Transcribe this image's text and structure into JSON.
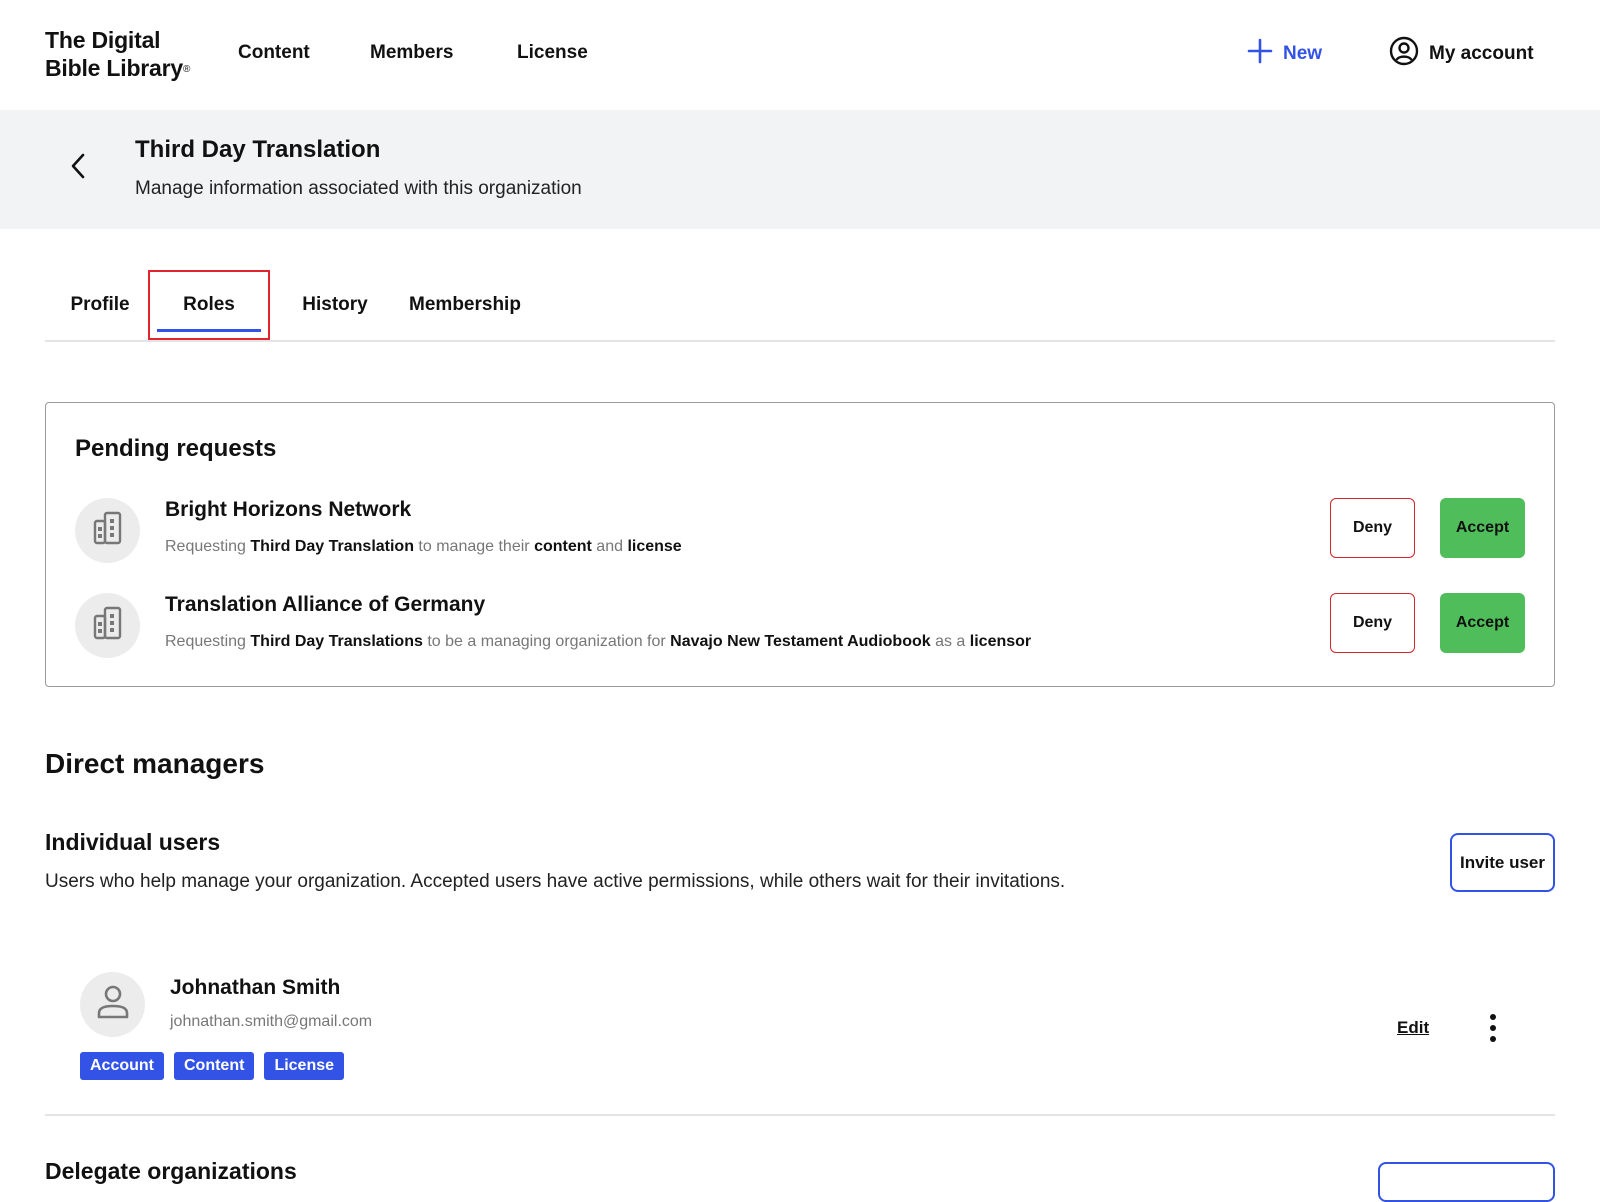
{
  "app": {
    "logo_line1": "The Digital",
    "logo_line2": "Bible Library",
    "logo_mark": "®"
  },
  "nav": {
    "content": "Content",
    "members": "Members",
    "license": "License",
    "new_label": "New",
    "account_label": "My account"
  },
  "header": {
    "title": "Third Day Translation",
    "subtitle": "Manage information associated with this organization"
  },
  "tabs": [
    {
      "label": "Profile"
    },
    {
      "label": "Roles"
    },
    {
      "label": "History"
    },
    {
      "label": "Membership"
    }
  ],
  "pending": {
    "title": "Pending requests",
    "requests": [
      {
        "name": "Bright Horizons Network",
        "desc_parts": [
          "Requesting ",
          "Third Day Translation",
          " to manage their ",
          "content",
          " and ",
          "license"
        ],
        "deny_label": "Deny",
        "accept_label": "Accept"
      },
      {
        "name": "Translation Alliance of Germany",
        "desc_parts": [
          "Requesting ",
          "Third Day Translations",
          " to be a managing organization for ",
          "Navajo New Testament Audiobook",
          " as a ",
          "licensor"
        ],
        "deny_label": "Deny",
        "accept_label": "Accept"
      }
    ]
  },
  "direct_managers": {
    "title": "Direct managers",
    "individual_title": "Individual users",
    "individual_desc": "Users who help manage your organization. Accepted users have active permissions, while others wait for their invitations.",
    "invite_label": "Invite user",
    "users": [
      {
        "name": "Johnathan Smith",
        "email": "johnathan.smith@gmail.com",
        "badges": [
          "Account",
          "Content",
          "License"
        ],
        "edit_label": "Edit"
      }
    ]
  },
  "delegate": {
    "title": "Delegate organizations"
  },
  "colors": {
    "accent": "#3253e6",
    "deny_border": "#d1262c",
    "accept_bg": "#4fbd5a",
    "highlight_box": "#e0262c"
  }
}
